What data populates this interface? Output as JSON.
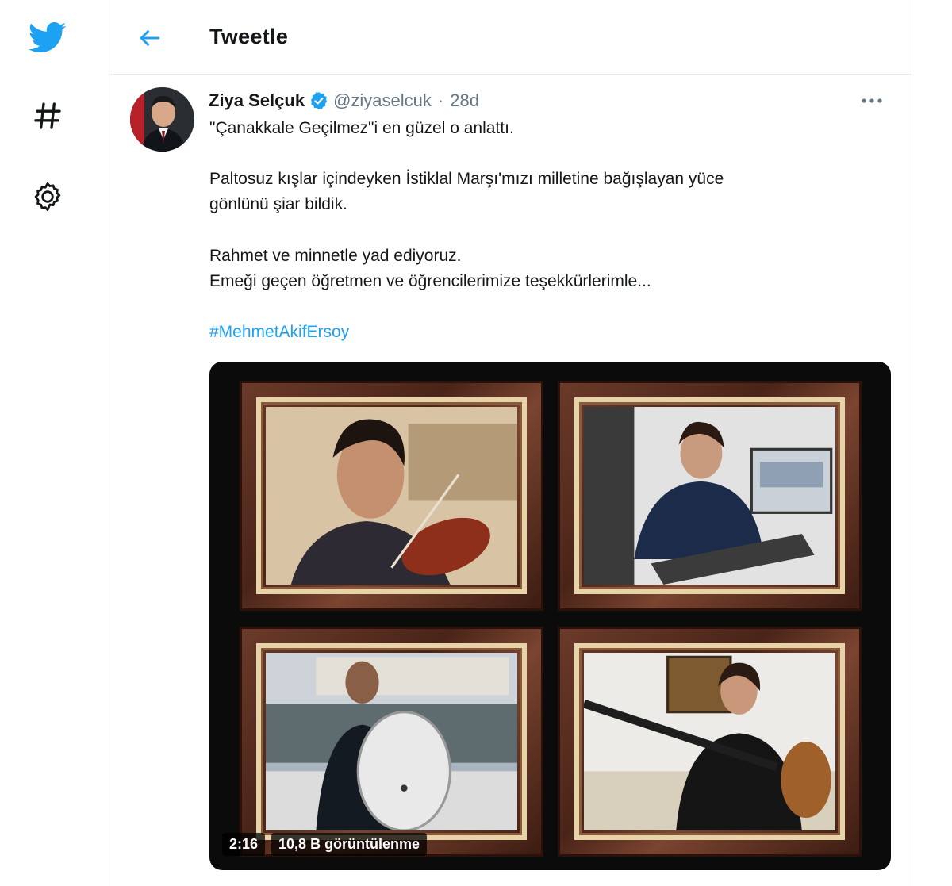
{
  "header": {
    "title": "Tweetle"
  },
  "tweet": {
    "author_name": "Ziya Selçuk",
    "handle": "@ziyaselcuk",
    "separator": "·",
    "age": "28d",
    "lines": [
      "\"Çanakkale Geçilmez\"i en güzel o anlattı.",
      "Paltosuz kışlar içindeyken İstiklal Marşı'mızı milletine bağışlayan yüce",
      "gönlünü şiar bildik.",
      "Rahmet ve minnetle yad ediyoruz.",
      "Emeği geçen öğretmen ve öğrencilerimize teşekkürlerimle..."
    ],
    "hashtag": "#MehmetAkifErsoy"
  },
  "video": {
    "duration": "2:16",
    "views": "10,8 B görüntülenme"
  },
  "icons": {
    "logo": "twitter-bird-icon",
    "explore": "hashtag-icon",
    "settings": "gear-icon",
    "back": "back-arrow-icon",
    "verified": "verified-badge-icon",
    "more": "more-options-icon"
  },
  "colors": {
    "brand": "#1da1f2",
    "text": "#14171a",
    "muted": "#657786",
    "border": "#e6ecf0"
  }
}
